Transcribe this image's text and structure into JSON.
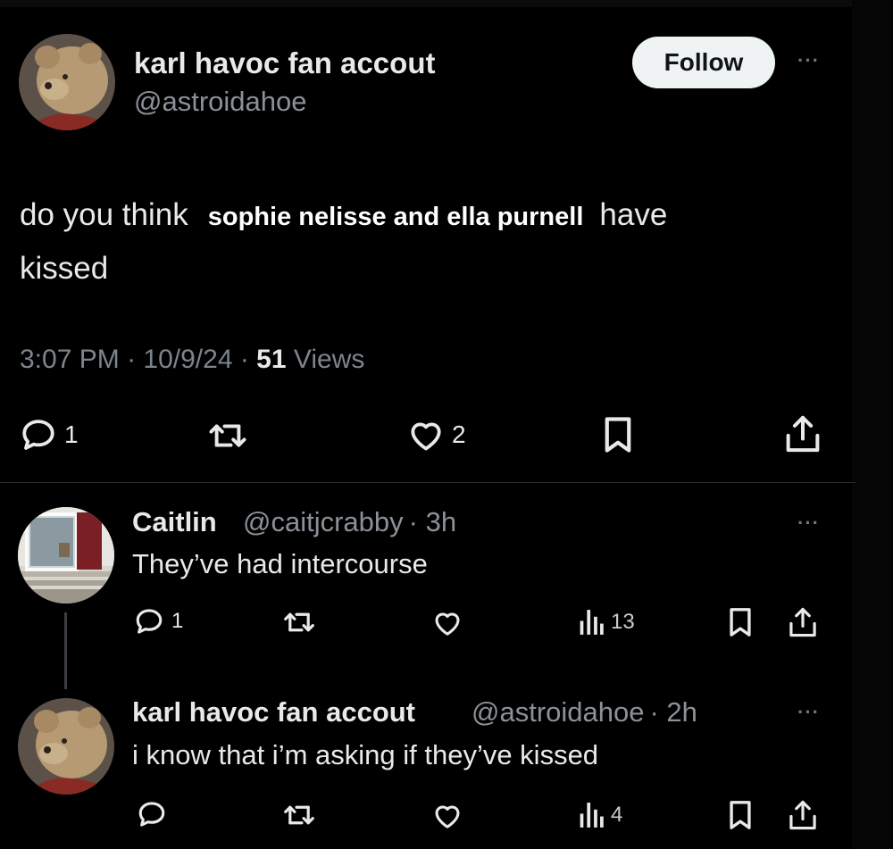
{
  "tweet": {
    "author_name": "karl havoc fan accout",
    "author_handle": "@astroidahoe",
    "follow_label": "Follow",
    "more_label": "···",
    "text_before": "do you think",
    "text_bold": "sophie nelisse and ella purnell",
    "text_after": "have",
    "text_line2": "kissed",
    "time": "3:07 PM",
    "sep1": " · ",
    "date": "10/9/24",
    "sep2": " · ",
    "views_count": "51",
    "views_label": "Views",
    "replies": "1",
    "likes": "2"
  },
  "replies": [
    {
      "author_name": "Caitlin",
      "author_handle": "@caitjcrabby",
      "time": "· 3h",
      "text": "They’ve had intercourse",
      "replies": "1",
      "views": "13",
      "more_label": "···"
    },
    {
      "author_name": "karl havoc fan accout",
      "author_handle": "@astroidahoe",
      "time": "· 2h",
      "text": "i know that i’m asking if they’ve kissed",
      "views": "4",
      "more_label": "···"
    }
  ],
  "colors": {
    "background": "#000000",
    "text": "#e7e9ea",
    "muted": "#7d848b",
    "button_bg": "#eff3f4"
  },
  "icons": [
    "reply-icon",
    "repost-icon",
    "like-icon",
    "bookmark-icon",
    "share-icon",
    "views-icon",
    "more-icon"
  ]
}
